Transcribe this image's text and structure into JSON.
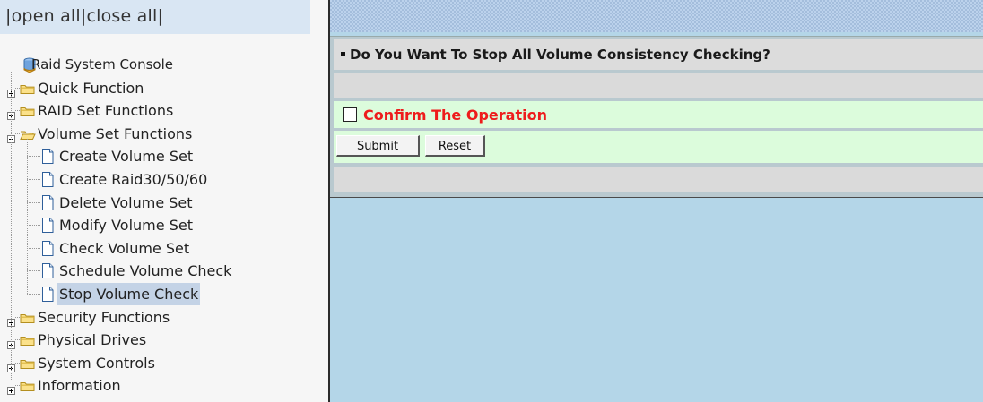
{
  "open_close": {
    "prefix": "|",
    "open_all": "open all",
    "sep": "|",
    "close_all": "close all",
    "suffix": "|"
  },
  "tree": {
    "root": {
      "label": "Raid System Console",
      "icon": "database-icon"
    },
    "groups": [
      {
        "label": "Quick Function",
        "expanded": false
      },
      {
        "label": "RAID Set Functions",
        "expanded": false
      },
      {
        "label": "Volume Set Functions",
        "expanded": true,
        "items": [
          "Create Volume Set",
          "Create Raid30/50/60",
          "Delete Volume Set",
          "Modify Volume Set",
          "Check Volume Set",
          "Schedule Volume Check",
          "Stop Volume Check"
        ],
        "selected_item": "Stop Volume Check"
      },
      {
        "label": "Security Functions",
        "expanded": false
      },
      {
        "label": "Physical Drives",
        "expanded": false
      },
      {
        "label": "System Controls",
        "expanded": false
      },
      {
        "label": "Information",
        "expanded": false
      }
    ]
  },
  "form": {
    "title": "Do You Want To Stop All Volume Consistency Checking?",
    "confirm_label": "Confirm The Operation",
    "confirm_checked": false,
    "submit_label": "Submit",
    "reset_label": "Reset"
  },
  "colors": {
    "confirm_text": "#ee1c1c",
    "content_bg": "#b4d6e8",
    "form_row_bg": "#dcfcdc",
    "selected_bg": "#c4d3e6"
  }
}
